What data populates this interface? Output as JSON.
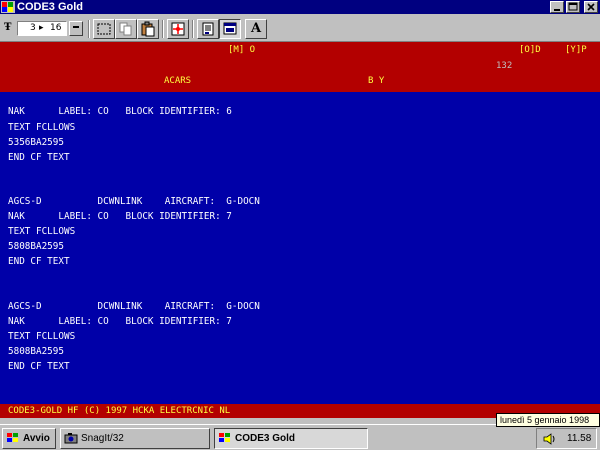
{
  "window": {
    "title": "CODE3 Gold",
    "min_icon": "minimize-icon",
    "max_icon": "maximize-icon",
    "close_icon": "close-icon"
  },
  "toolbar": {
    "font_size_left": "3",
    "font_size_arrow": "▸",
    "font_size_right": "16",
    "font_glyph": "Ŧ",
    "bold_label": "A"
  },
  "header": {
    "mode_m": "[M] O",
    "mode_o": "[O]D",
    "mode_y": "[Y]P",
    "count": "132",
    "channel": "ACARS",
    "by": "B Y"
  },
  "messages": [
    {
      "line1": "NAK      LABEL: CO   BLOCK IDENTIFIER: 6",
      "line2": "TEXT FCLLOWS",
      "line3": "5356BA2595",
      "line4": "END CF TEXT"
    },
    {
      "line0": "AGCS-D          DCWNLINK    AIRCRAFT:  G-DOCN",
      "line1": "NAK      LABEL: CO   BLOCK IDENTIFIER: 7",
      "line2": "TEXT FCLLOWS",
      "line3": "5808BA2595",
      "line4": "END CF TEXT"
    },
    {
      "line0": "AGCS-D          DCWNLINK    AIRCRAFT:  G-DOCN",
      "line1": "NAK      LABEL: CO   BLOCK IDENTIFIER: 7",
      "line2": "TEXT FCLLOWS",
      "line3": "5808BA2595",
      "line4": "END CF TEXT"
    }
  ],
  "status": {
    "text": "CODE3-GOLD HF (C) 1997 HCKA ELECTRCNIC NL"
  },
  "tooltip": {
    "text": "lunedì 5 gennaio 1998"
  },
  "taskbar": {
    "start_label": "Avvio",
    "task1_label": "SnagIt/32",
    "task2_label": "CODE3 Gold",
    "clock": "11.58"
  },
  "colors": {
    "titlebar": "#000080",
    "header_bg": "#b30000",
    "header_text": "#ffff40",
    "terminal_bg": "#0000a8",
    "terminal_text": "#ffffff"
  }
}
